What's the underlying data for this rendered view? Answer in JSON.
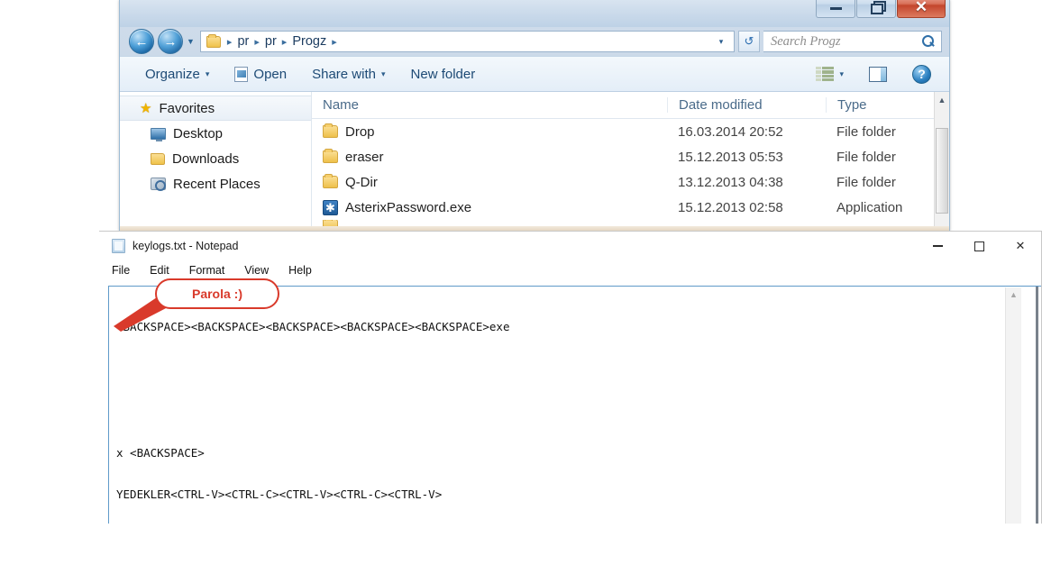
{
  "explorer": {
    "window_controls": {
      "minimize": "minimize-button",
      "restore": "restore-button",
      "close": "close-button",
      "close_glyph": "✕"
    },
    "nav": {
      "back": "←",
      "forward": "→",
      "recent_caret": "▼"
    },
    "address": {
      "crumbs": [
        "pr",
        "pr",
        "Progz"
      ],
      "separator": "▸",
      "dropdown": "▾",
      "refresh": "↺"
    },
    "search": {
      "placeholder": "Search Progz"
    },
    "toolbar": {
      "organize": "Organize",
      "open": "Open",
      "share_with": "Share with",
      "new_folder": "New folder",
      "caret": "▾",
      "help": "?"
    },
    "nav_pane": {
      "items": [
        {
          "label": "Favorites",
          "icon": "star-icon"
        },
        {
          "label": "Desktop",
          "icon": "desktop-icon"
        },
        {
          "label": "Downloads",
          "icon": "downloads-folder-icon"
        },
        {
          "label": "Recent Places",
          "icon": "recent-places-icon"
        }
      ]
    },
    "columns": [
      "Name",
      "Date modified",
      "Type"
    ],
    "rows": [
      {
        "name": "Drop",
        "date": "16.03.2014 20:52",
        "type": "File folder",
        "icon": "folder-icon"
      },
      {
        "name": "eraser",
        "date": "15.12.2013 05:53",
        "type": "File folder",
        "icon": "folder-icon"
      },
      {
        "name": "Q-Dir",
        "date": "13.12.2013 04:38",
        "type": "File folder",
        "icon": "folder-icon"
      },
      {
        "name": "AsterixPassword.exe",
        "date": "15.12.2013 02:58",
        "type": "Application",
        "icon": "application-icon",
        "glyph": "✱"
      }
    ],
    "scroll_up_arrow": "▲"
  },
  "notepad": {
    "title": "keylogs.txt - Notepad",
    "menu": [
      "File",
      "Edit",
      "Format",
      "View",
      "Help"
    ],
    "controls": {
      "minimize": "minimize",
      "maximize": "maximize",
      "close": "✕"
    },
    "content_lines": [
      "<BACKSPACE><BACKSPACE><BACKSPACE><BACKSPACE><BACKSPACE>exe",
      "",
      "",
      "x <BACKSPACE>",
      "YEDEKLER<CTRL-V><CTRL-C><CTRL-V><CTRL-C><CTRL-V>"
    ],
    "scroll_up_arrow": "▲"
  },
  "annotation": {
    "label": "Parola :)",
    "color": "#d93a2b"
  }
}
